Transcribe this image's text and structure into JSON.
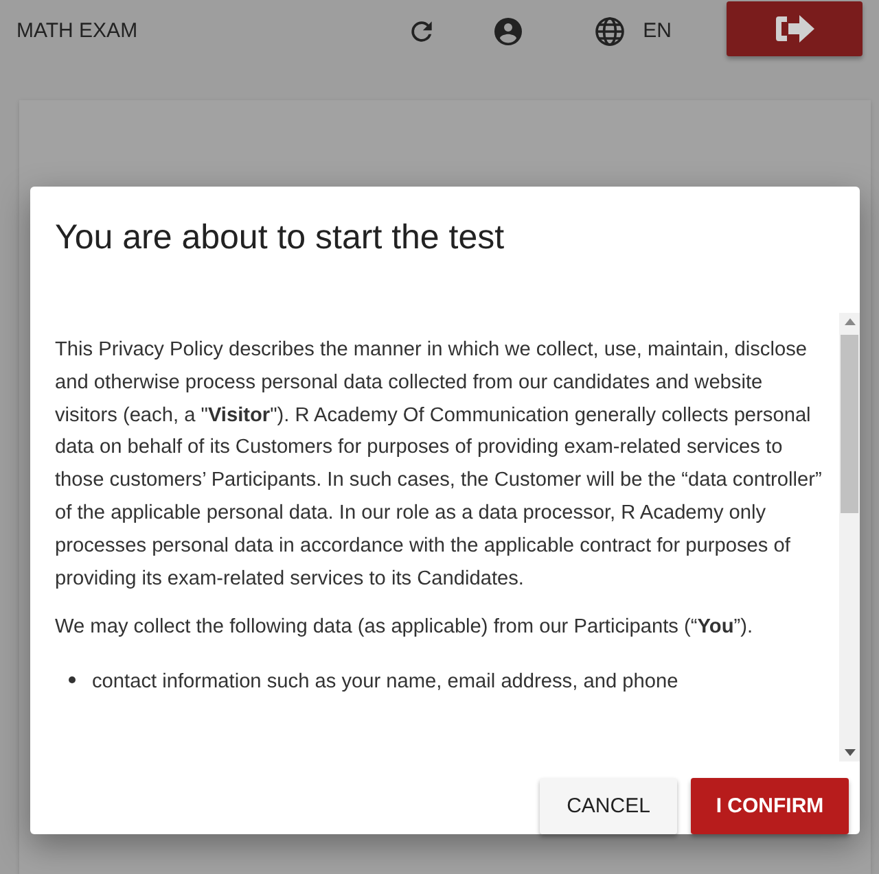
{
  "header": {
    "title": "MATH EXAM",
    "language": "EN"
  },
  "dialog": {
    "title": "You are about to start the test",
    "content": [
      {
        "kind": "paragraph",
        "text": "This Privacy Policy describes the manner in which we collect, use, maintain, disclose and otherwise process personal data collected from our candidates and website visitors (each, a \"**Visitor**\"). R Academy Of Communication generally collects personal data on behalf of its Customers for purposes of providing exam-related services to those customers’ Participants. In such cases, the Customer will be the “data controller” of the applicable personal data. In our role as a data processor, R Academy only processes personal data in accordance with the applicable contract for purposes of providing its exam-related services to its Candidates."
      },
      {
        "kind": "paragraph",
        "text": "We may collect the following data (as applicable) from our Participants (“**You**”)."
      },
      {
        "kind": "bullet",
        "text": "contact information such as your name, email address, and phone"
      }
    ],
    "buttons": [
      {
        "label": "CANCEL",
        "kind": "secondary"
      },
      {
        "label": "I CONFIRM",
        "kind": "primary"
      }
    ]
  }
}
